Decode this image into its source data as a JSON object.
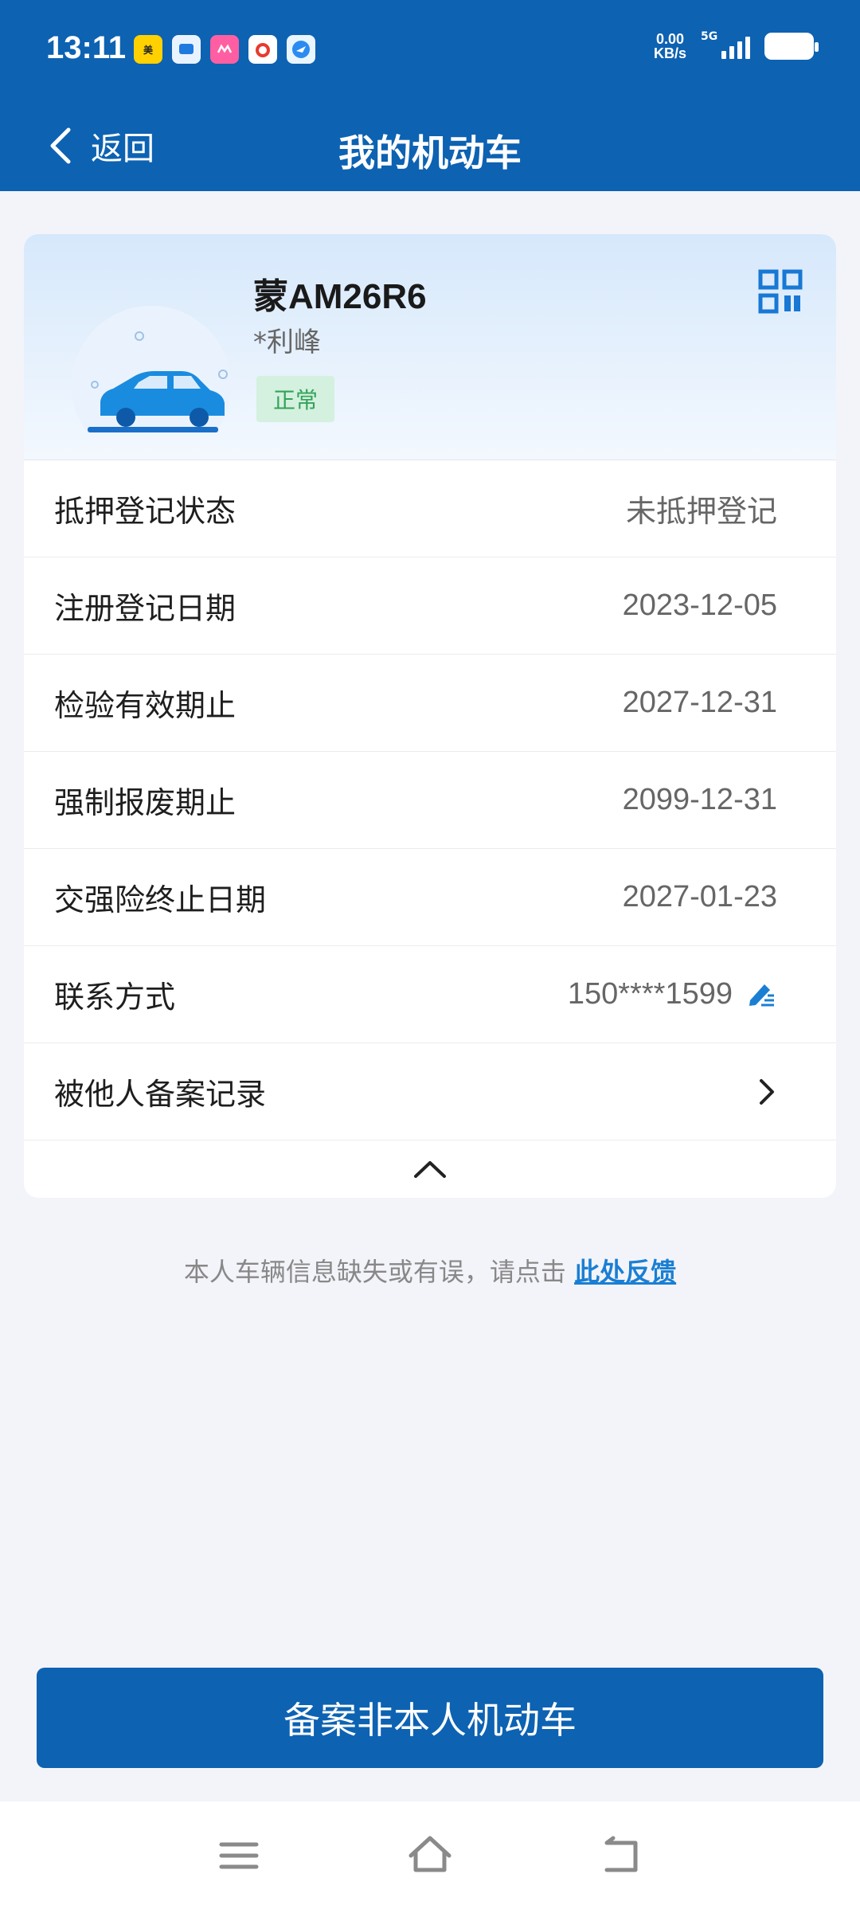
{
  "status_bar": {
    "time": "13:11",
    "speed_value": "0.00",
    "speed_unit": "KB/s",
    "network": "5G",
    "app_icons": [
      "meituan-app-icon",
      "blue-app-icon",
      "pink-app-icon",
      "red-character-app-icon",
      "blue-bird-app-icon"
    ]
  },
  "nav": {
    "back_label": "返回",
    "title": "我的机动车"
  },
  "vehicle": {
    "plate": "蒙AM26R6",
    "owner": "*利峰",
    "status": "正常"
  },
  "details": [
    {
      "label": "抵押登记状态",
      "value": "未抵押登记"
    },
    {
      "label": "注册登记日期",
      "value": "2023-12-05"
    },
    {
      "label": "检验有效期止",
      "value": "2027-12-31"
    },
    {
      "label": "强制报废期止",
      "value": "2099-12-31"
    },
    {
      "label": "交强险终止日期",
      "value": "2027-01-23"
    },
    {
      "label": "联系方式",
      "value": "150****1599"
    },
    {
      "label": "被他人备案记录",
      "value": ""
    }
  ],
  "feedback": {
    "text": "本人车辆信息缺失或有误，请点击",
    "link": "此处反馈"
  },
  "main_button": {
    "label": "备案非本人机动车"
  },
  "colors": {
    "primary": "#0d62b2",
    "badge_bg": "#d3f1de",
    "badge_text": "#34a25a",
    "link": "#1a7fd3"
  }
}
